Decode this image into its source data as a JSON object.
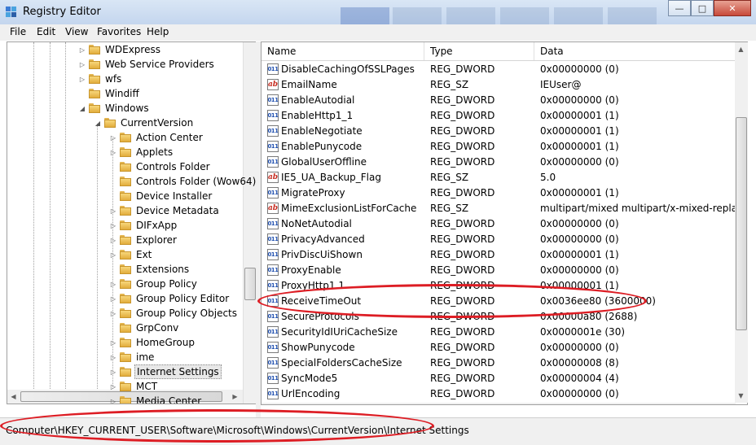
{
  "window": {
    "title": "Registry Editor"
  },
  "menu": {
    "file": "File",
    "edit": "Edit",
    "view": "View",
    "favorites": "Favorites",
    "help": "Help"
  },
  "tree": [
    {
      "label": "WDExpress",
      "level": 3,
      "expander": "collapsed"
    },
    {
      "label": "Web Service Providers",
      "level": 3,
      "expander": "collapsed"
    },
    {
      "label": "wfs",
      "level": 3,
      "expander": "collapsed"
    },
    {
      "label": "Windiff",
      "level": 3,
      "expander": "none"
    },
    {
      "label": "Windows",
      "level": 3,
      "expander": "expanded"
    },
    {
      "label": "CurrentVersion",
      "level": 4,
      "expander": "expanded"
    },
    {
      "label": "Action Center",
      "level": 5,
      "expander": "collapsed"
    },
    {
      "label": "Applets",
      "level": 5,
      "expander": "collapsed"
    },
    {
      "label": "Controls Folder",
      "level": 5,
      "expander": "none"
    },
    {
      "label": "Controls Folder (Wow64)",
      "level": 5,
      "expander": "none"
    },
    {
      "label": "Device Installer",
      "level": 5,
      "expander": "none"
    },
    {
      "label": "Device Metadata",
      "level": 5,
      "expander": "collapsed"
    },
    {
      "label": "DIFxApp",
      "level": 5,
      "expander": "collapsed"
    },
    {
      "label": "Explorer",
      "level": 5,
      "expander": "collapsed"
    },
    {
      "label": "Ext",
      "level": 5,
      "expander": "collapsed"
    },
    {
      "label": "Extensions",
      "level": 5,
      "expander": "none"
    },
    {
      "label": "Group Policy",
      "level": 5,
      "expander": "collapsed"
    },
    {
      "label": "Group Policy Editor",
      "level": 5,
      "expander": "collapsed"
    },
    {
      "label": "Group Policy Objects",
      "level": 5,
      "expander": "collapsed"
    },
    {
      "label": "GrpConv",
      "level": 5,
      "expander": "none"
    },
    {
      "label": "HomeGroup",
      "level": 5,
      "expander": "collapsed"
    },
    {
      "label": "ime",
      "level": 5,
      "expander": "collapsed"
    },
    {
      "label": "Internet Settings",
      "level": 5,
      "expander": "collapsed",
      "selected": true
    },
    {
      "label": "MCT",
      "level": 5,
      "expander": "collapsed"
    },
    {
      "label": "Media Center",
      "level": 5,
      "expander": "collapsed"
    }
  ],
  "columns": {
    "name": "Name",
    "type": "Type",
    "data": "Data"
  },
  "values": [
    {
      "name": "DisableCachingOfSSLPages",
      "type": "REG_DWORD",
      "data": "0x00000000 (0)",
      "icon": "dword"
    },
    {
      "name": "EmailName",
      "type": "REG_SZ",
      "data": "IEUser@",
      "icon": "string"
    },
    {
      "name": "EnableAutodial",
      "type": "REG_DWORD",
      "data": "0x00000000 (0)",
      "icon": "dword"
    },
    {
      "name": "EnableHttp1_1",
      "type": "REG_DWORD",
      "data": "0x00000001 (1)",
      "icon": "dword"
    },
    {
      "name": "EnableNegotiate",
      "type": "REG_DWORD",
      "data": "0x00000001 (1)",
      "icon": "dword"
    },
    {
      "name": "EnablePunycode",
      "type": "REG_DWORD",
      "data": "0x00000001 (1)",
      "icon": "dword"
    },
    {
      "name": "GlobalUserOffline",
      "type": "REG_DWORD",
      "data": "0x00000000 (0)",
      "icon": "dword"
    },
    {
      "name": "IE5_UA_Backup_Flag",
      "type": "REG_SZ",
      "data": "5.0",
      "icon": "string"
    },
    {
      "name": "MigrateProxy",
      "type": "REG_DWORD",
      "data": "0x00000001 (1)",
      "icon": "dword"
    },
    {
      "name": "MimeExclusionListForCache",
      "type": "REG_SZ",
      "data": "multipart/mixed multipart/x-mixed-replace m",
      "icon": "string"
    },
    {
      "name": "NoNetAutodial",
      "type": "REG_DWORD",
      "data": "0x00000000 (0)",
      "icon": "dword"
    },
    {
      "name": "PrivacyAdvanced",
      "type": "REG_DWORD",
      "data": "0x00000000 (0)",
      "icon": "dword"
    },
    {
      "name": "PrivDiscUiShown",
      "type": "REG_DWORD",
      "data": "0x00000001 (1)",
      "icon": "dword"
    },
    {
      "name": "ProxyEnable",
      "type": "REG_DWORD",
      "data": "0x00000000 (0)",
      "icon": "dword"
    },
    {
      "name": "ProxyHttp1.1",
      "type": "REG_DWORD",
      "data": "0x00000001 (1)",
      "icon": "dword"
    },
    {
      "name": "ReceiveTimeOut",
      "type": "REG_DWORD",
      "data": "0x0036ee80 (3600000)",
      "icon": "dword"
    },
    {
      "name": "SecureProtocols",
      "type": "REG_DWORD",
      "data": "0x00000a80 (2688)",
      "icon": "dword"
    },
    {
      "name": "SecurityIdIUriCacheSize",
      "type": "REG_DWORD",
      "data": "0x0000001e (30)",
      "icon": "dword"
    },
    {
      "name": "ShowPunycode",
      "type": "REG_DWORD",
      "data": "0x00000000 (0)",
      "icon": "dword"
    },
    {
      "name": "SpecialFoldersCacheSize",
      "type": "REG_DWORD",
      "data": "0x00000008 (8)",
      "icon": "dword"
    },
    {
      "name": "SyncMode5",
      "type": "REG_DWORD",
      "data": "0x00000004 (4)",
      "icon": "dword"
    },
    {
      "name": "UrlEncoding",
      "type": "REG_DWORD",
      "data": "0x00000000 (0)",
      "icon": "dword"
    }
  ],
  "icons": {
    "string": "ab",
    "dword": "011"
  },
  "status": {
    "path": "Computer\\HKEY_CURRENT_USER\\Software\\Microsoft\\Windows\\CurrentVersion\\Internet Settings"
  },
  "annotation_color": "#dd1d24"
}
